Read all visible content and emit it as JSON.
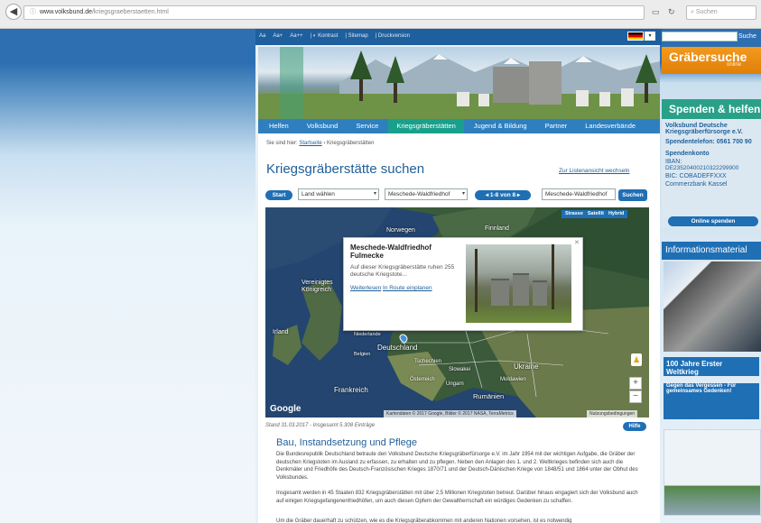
{
  "browser": {
    "url_domain": "www.volksbund.de",
    "url_path": "/kriegsgraeberstaetten.html",
    "search_placeholder": "Suchen"
  },
  "util_bar": {
    "items": [
      "Aa",
      "Aa+",
      "Aa++",
      "| ◐ Kontrast",
      "| Sitemap",
      "| Druckversion"
    ]
  },
  "site_search_button": "Suche",
  "grabersuche": {
    "label": "Gräbersuche",
    "sub": "online"
  },
  "nav": {
    "items": [
      "Helfen",
      "Volksbund",
      "Service",
      "Kriegsgräberstätten",
      "Jugend & Bildung",
      "Partner",
      "Landesverbände"
    ],
    "active_index": 3
  },
  "breadcrumb": {
    "prefix": "Sie sind hier:",
    "home": "Startseite",
    "current": "› Kriegsgräberstätten"
  },
  "page_title": "Kriegsgräberstätte suchen",
  "list_link": "Zur Listenansicht wechseln",
  "filter": {
    "start_label": "Start",
    "land_select": "Land wählen",
    "cemetery_select": "Meschede-Waldfriedhof",
    "pager": "1-8 von 8",
    "search_value": "Meschede-Waldfriedhof",
    "search_button": "Suchen"
  },
  "map": {
    "type_buttons": [
      "Strasse",
      "Satellit",
      "Hybrid"
    ],
    "labels": [
      {
        "name": "Norwegen",
        "key": "norwegen"
      },
      {
        "name": "Finnland",
        "key": "finnland"
      },
      {
        "name": "Vereinigtes Königreich",
        "key": "uk"
      },
      {
        "name": "Irland",
        "key": "irland"
      },
      {
        "name": "Niederlande",
        "key": "niederlande"
      },
      {
        "name": "Deutschland",
        "key": "deutschland"
      },
      {
        "name": "Belgien",
        "key": "belgien"
      },
      {
        "name": "Tschechien",
        "key": "tschechien"
      },
      {
        "name": "Slowakei",
        "key": "slowakei"
      },
      {
        "name": "Österreich",
        "key": "oesterreich"
      },
      {
        "name": "Ungarn",
        "key": "ungarn"
      },
      {
        "name": "Ukraine",
        "key": "ukraine"
      },
      {
        "name": "Moldawien",
        "key": "moldawien"
      },
      {
        "name": "Frankreich",
        "key": "frankreich"
      },
      {
        "name": "Rumänien",
        "key": "rumaenien"
      }
    ],
    "google_logo": "Google",
    "attribution": "Kartendaten © 2017 Google, Bilder © 2017 NASA, TerraMetrics",
    "terms": "Nutzungsbedingungen"
  },
  "info_window": {
    "title": "Meschede-Waldfriedhof Fulmecke",
    "text": "Auf dieser Kriegsgräberstätte ruhen 255 deutsche Kriegstote...",
    "link_more": "Weiterlesen",
    "link_route": "In Route einplanen"
  },
  "stand": "Stand 31.03.2017 - Insgesamt 5.308 Einträge",
  "help_button": "Hilfe",
  "section": {
    "title": "Bau, Instandsetzung und Pflege",
    "para1": "Die Bundesrepublik Deutschland betraute den Volksbund Deutsche Kriegsgräberfürsorge e.V. im Jahr 1954 mit der wichtigen Aufgabe, die Gräber der deutschen Kriegstoten im Ausland zu erfassen, zu erhalten und zu pflegen. Neben den Anlagen des 1. und 2. Weltkrieges befinden sich auch die Denkmäler und Friedhöfe des Deutsch-Französischen Krieges 1870/71 und der Deutsch-Dänischen Kriege von 1848/51 und 1864 unter der Obhut des Volksbundes.",
    "para2": "Insgesamt werden in 45 Staaten 832 Kriegsgräberstätten mit über 2,5 Millionen Kriegstoten betreut. Darüber hinaus engagiert sich der Volksbund auch auf einigen Kriegsgefangenenfriedhöfen, um auch diesen Opfern der Gewaltherrschaft ein würdiges Gedenken zu schaffen.",
    "para3": "Um die Gräber dauerhaft zu schützen, wie es die Kriegsgräberabkommen mit anderen Nationen vorsehen, ist es notwendig"
  },
  "sidebar": {
    "spenden_head": "Spenden & helfen",
    "org": "Volksbund Deutsche Kriegsgräberfürsorge e.V.",
    "phone": "Spendentelefon: 0561 700 90",
    "konto_label": "Spendenkonto",
    "iban": "IBAN:",
    "iban_value": "DE23520400210322299900",
    "bic": "BIC: COBADEFFXXX",
    "bank": "Commerzbank Kassel",
    "online_button": "Online spenden",
    "info_head": "Informationsmaterial",
    "info_title": "100 Jahre Erster Weltkrieg",
    "info_sub": "Gegen das Vergessen - Für gemeinsames Gedenken!"
  },
  "colors": {
    "brand_blue": "#1f6fb5",
    "nav_active": "#19a08c",
    "accent_orange": "#f39a1f",
    "title_blue": "#1f5f99"
  }
}
